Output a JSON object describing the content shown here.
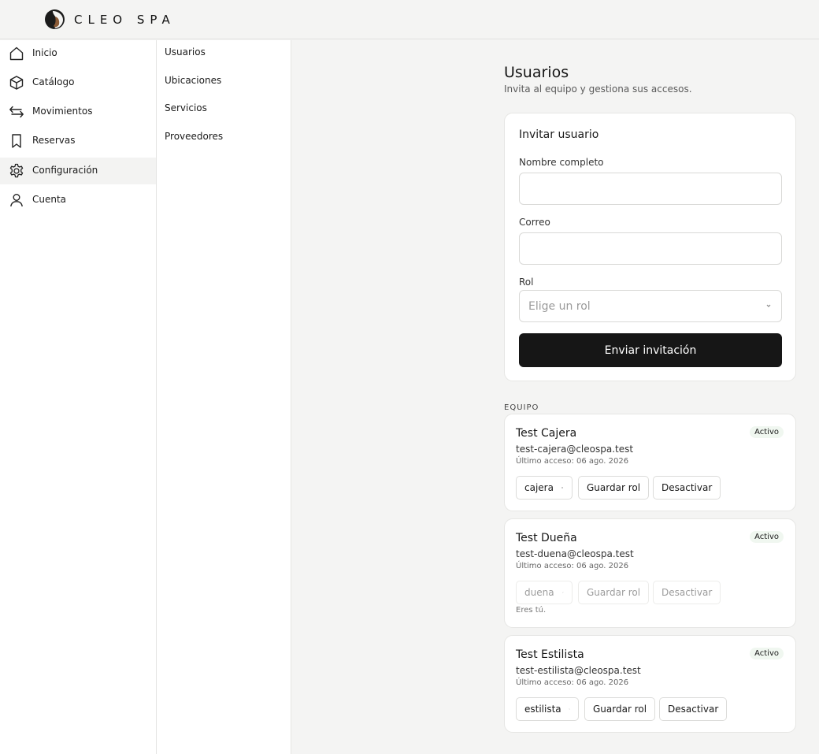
{
  "brand": {
    "name": "CLEO SPA"
  },
  "sidebar": {
    "items": [
      {
        "label": "Inicio",
        "icon": "home-icon"
      },
      {
        "label": "Catálogo",
        "icon": "box-icon"
      },
      {
        "label": "Movimientos",
        "icon": "arrows-icon"
      },
      {
        "label": "Reservas",
        "icon": "bookmark-icon"
      },
      {
        "label": "Configuración",
        "icon": "gear-icon",
        "active": true
      },
      {
        "label": "Cuenta",
        "icon": "user-icon"
      }
    ]
  },
  "subnav": {
    "items": [
      {
        "label": "Usuarios"
      },
      {
        "label": "Ubicaciones"
      },
      {
        "label": "Servicios"
      },
      {
        "label": "Proveedores"
      }
    ]
  },
  "page": {
    "title": "Usuarios",
    "subtitle": "Invita al equipo y gestiona sus accesos."
  },
  "invite": {
    "title": "Invitar usuario",
    "name_label": "Nombre completo",
    "name_value": "",
    "email_label": "Correo",
    "email_value": "",
    "role_label": "Rol",
    "role_placeholder": "Elige un rol",
    "submit_label": "Enviar invitación"
  },
  "team": {
    "section_label": "EQUIPO",
    "save_label": "Guardar rol",
    "deactivate_label": "Desactivar",
    "members": [
      {
        "name": "Test Cajera",
        "email": "test-cajera@cleospa.test",
        "last_access": "Último acceso: 06 ago. 2026",
        "status": "Activo",
        "role": "cajera",
        "note": ""
      },
      {
        "name": "Test Dueña",
        "email": "test-duena@cleospa.test",
        "last_access": "Último acceso: 06 ago. 2026",
        "status": "Activo",
        "role": "duena",
        "note": "Eres tú."
      },
      {
        "name": "Test Estilista",
        "email": "test-estilista@cleospa.test",
        "last_access": "Último acceso: 06 ago. 2026",
        "status": "Activo",
        "role": "estilista",
        "note": ""
      }
    ]
  },
  "colors": {
    "primary_button": "#161616",
    "background": "#f4f4f3",
    "card": "#ffffff"
  }
}
